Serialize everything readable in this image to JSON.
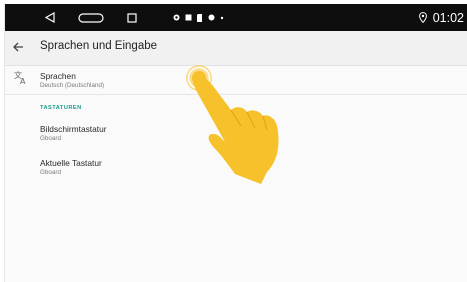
{
  "status_bar": {
    "time": "01:02",
    "nav": {
      "back_icon": "triangle-back-icon",
      "home_icon": "home-pill-icon",
      "recents_icon": "square-recents-icon"
    },
    "notification_icons": [
      "location-icon",
      "message-icon",
      "sd-card-icon",
      "dot-icon",
      "small-dot-icon"
    ],
    "location_icon": "location-pin-icon"
  },
  "app_bar": {
    "back_icon": "arrow-back-icon",
    "title": "Sprachen und Eingabe"
  },
  "list": {
    "languages": {
      "icon": "translate-icon",
      "title": "Sprachen",
      "subtitle": "Deutsch (Deutschland)"
    },
    "section_header": "TASTATUREN",
    "onscreen_keyboard": {
      "title": "Bildschirmtastatur",
      "subtitle": "Gboard"
    },
    "current_keyboard": {
      "title": "Aktuelle Tastatur",
      "subtitle": "Gboard"
    }
  },
  "overlay": {
    "tap_hint_icon": "tap-hand-icon",
    "accent_color": "#f7c12b"
  }
}
